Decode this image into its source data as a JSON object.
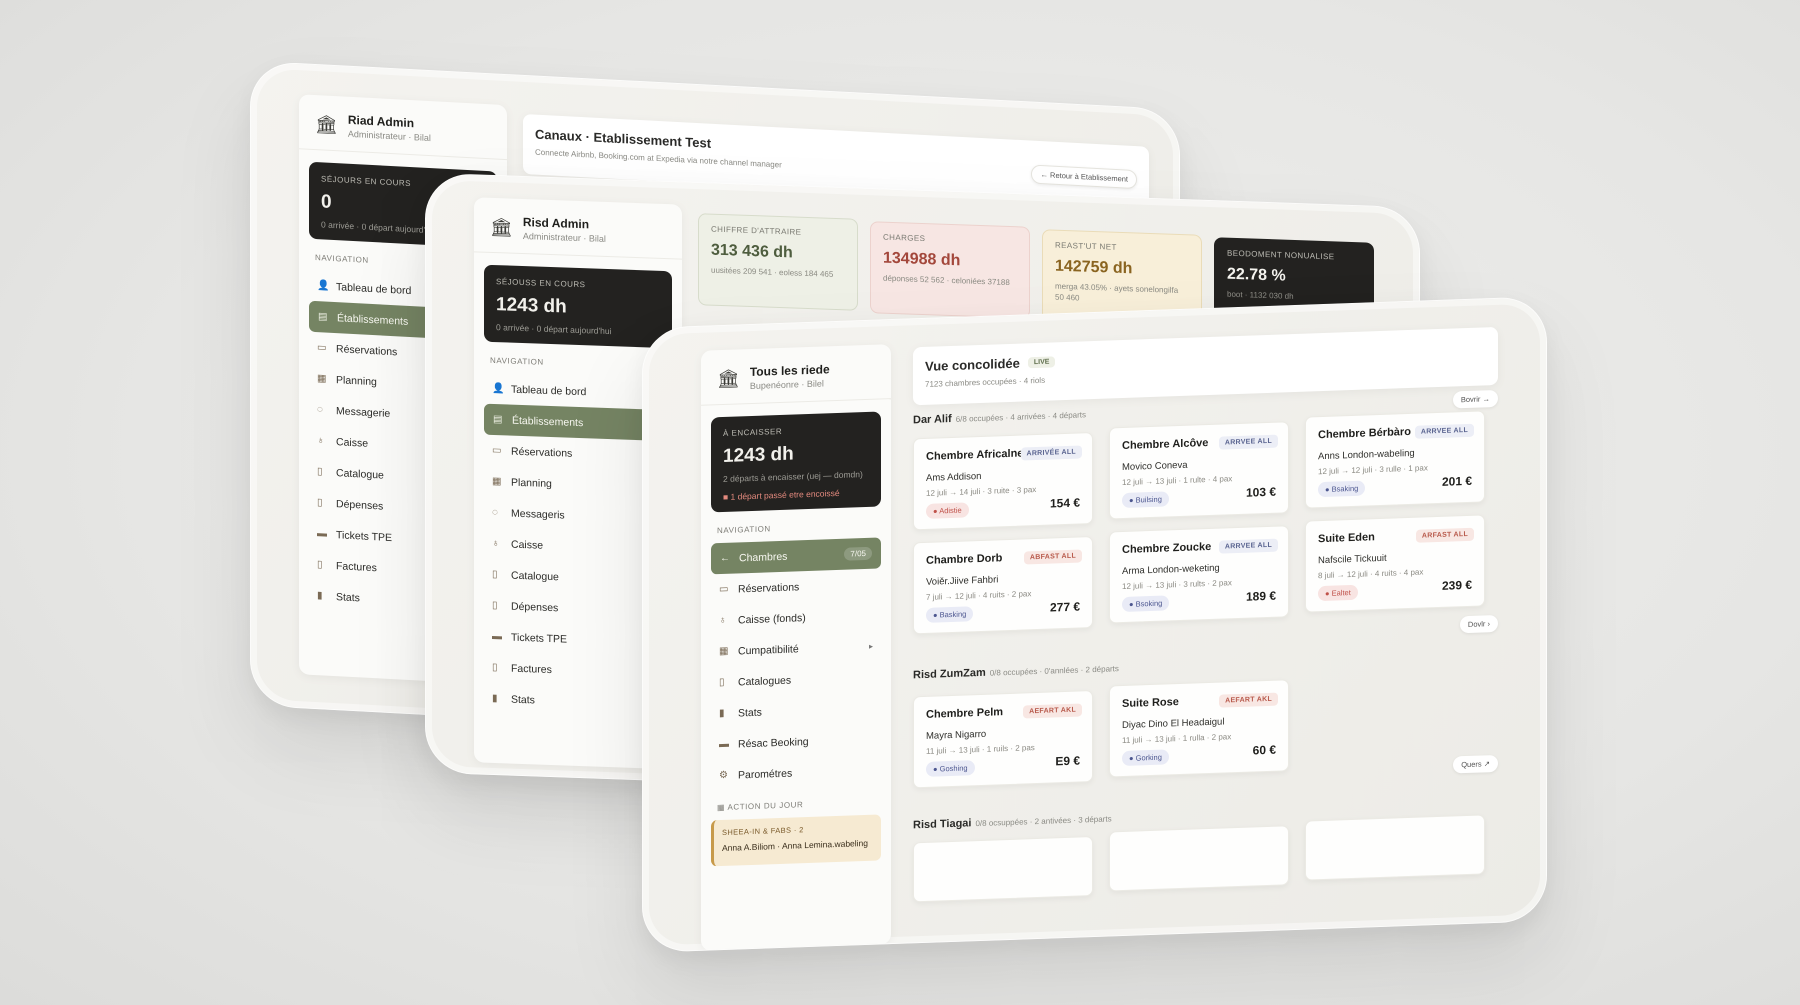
{
  "screen_back": {
    "brand": {
      "title": "Riad Admin",
      "subtitle": "Administrateur · Bilal"
    },
    "dark_card": {
      "label": "Séjours en cours",
      "value": "0",
      "sub": "0 arrivée · 0 départ aujourd'hui"
    },
    "nav_head": "Navigation",
    "nav": [
      {
        "icon": "person-icon",
        "glyph": "👤",
        "label": "Tableau de bord"
      },
      {
        "icon": "building-icon",
        "glyph": "▤",
        "label": "Établissements",
        "active": true
      },
      {
        "icon": "book-icon",
        "glyph": "▭",
        "label": "Réservations"
      },
      {
        "icon": "calendar-icon",
        "glyph": "▦",
        "label": "Planning"
      },
      {
        "icon": "chat-icon",
        "glyph": "◌",
        "label": "Messagerie"
      },
      {
        "icon": "moneybag-icon",
        "glyph": "♁",
        "label": "Caisse"
      },
      {
        "icon": "catalog-icon",
        "glyph": "▯",
        "label": "Catalogue"
      },
      {
        "icon": "document-icon",
        "glyph": "▯",
        "label": "Dépenses"
      },
      {
        "icon": "card-icon",
        "glyph": "▬",
        "label": "Tickets TPE"
      },
      {
        "icon": "invoice-icon",
        "glyph": "▯",
        "label": "Factures"
      },
      {
        "icon": "chart-icon",
        "glyph": "▮",
        "label": "Stats"
      }
    ],
    "header": {
      "title": "Canaux · Etablissement Test",
      "subtitle": "Connecte Airbnb, Booking.com at Expedia via notre channel manager",
      "back_button": "← Retour à Etablissement"
    }
  },
  "screen_mid": {
    "brand": {
      "title": "Risd Admin",
      "subtitle": "Administrateur · Bilal"
    },
    "dark_card": {
      "label": "Séjouss en cours",
      "value": "1243 dh",
      "sub": "0 arrivée · 0 départ aujourd'hui"
    },
    "nav_head": "Navigation",
    "nav": [
      {
        "icon": "person-icon",
        "glyph": "👤",
        "label": "Tableau de bord"
      },
      {
        "icon": "building-icon",
        "glyph": "▤",
        "label": "Établissements",
        "active": true
      },
      {
        "icon": "book-icon",
        "glyph": "▭",
        "label": "Réservations"
      },
      {
        "icon": "calendar-icon",
        "glyph": "▦",
        "label": "Planning"
      },
      {
        "icon": "chat-icon",
        "glyph": "◌",
        "label": "Messageris"
      },
      {
        "icon": "moneybag-icon",
        "glyph": "♁",
        "label": "Caisse"
      },
      {
        "icon": "catalog-icon",
        "glyph": "▯",
        "label": "Catalogue"
      },
      {
        "icon": "document-icon",
        "glyph": "▯",
        "label": "Dépenses"
      },
      {
        "icon": "card-icon",
        "glyph": "▬",
        "label": "Tickets TPE"
      },
      {
        "icon": "invoice-icon",
        "glyph": "▯",
        "label": "Factures"
      },
      {
        "icon": "chart-icon",
        "glyph": "▮",
        "label": "Stats"
      }
    ],
    "stats": [
      {
        "label": "Chiffre d'attraire",
        "value": "313 436 dh",
        "sub": "uusitées 209 541 · eoless 184 465",
        "bg": "#eef0e6",
        "border": "#d7dccb",
        "color": "#4e5d3e"
      },
      {
        "label": "Charges",
        "value": "134988 dh",
        "sub": "déponses 52 562 · celoniées 37188",
        "bg": "#f7e6e3",
        "border": "#ecd2cd",
        "color": "#a3473b"
      },
      {
        "label": "Reast'ut net",
        "value": "142759 dh",
        "sub": "merga 43.05% · ayets sonelongilfa 50 460",
        "bg": "#f8efd9",
        "border": "#eadcb8",
        "color": "#8a6420"
      },
      {
        "label": "Beodoment nonualise",
        "value": "22.78 %",
        "sub": "boot · 1132 030 dh",
        "bg": "#232220",
        "border": "#232220",
        "color": "#f4f3ee"
      }
    ]
  },
  "screen_front": {
    "brand": {
      "title": "Tous les riede",
      "subtitle": "Bupenéonre · Bilel"
    },
    "dark_card": {
      "label": "À encaisser",
      "value": "1243 dh",
      "sub": "2 départs à encaisser (uej — domdn)",
      "warn": "1 départ passé etre encoissé"
    },
    "nav_head": "Navigation",
    "nav": [
      {
        "icon": "arrow-left-icon",
        "glyph": "←",
        "label": "Chambres",
        "active": true,
        "badge": "7/05"
      },
      {
        "icon": "book-icon",
        "glyph": "▭",
        "label": "Réservations"
      },
      {
        "icon": "moneybag-icon",
        "glyph": "♁",
        "label": "Caisse (fonds)"
      },
      {
        "icon": "ledger-icon",
        "glyph": "▦",
        "label": "Cumpatibilité",
        "chevron": "▸"
      },
      {
        "icon": "catalog-icon",
        "glyph": "▯",
        "label": "Catalogues"
      },
      {
        "icon": "chart-icon",
        "glyph": "▮",
        "label": "Stats"
      },
      {
        "icon": "folder-icon",
        "glyph": "▬",
        "label": "Résac Beoking"
      },
      {
        "icon": "gear-icon",
        "glyph": "⚙",
        "label": "Parométres"
      }
    ],
    "action_head": "Action du jour",
    "action_card": {
      "label": "Sheea-in & fabs · 2",
      "text": "Anna A.Biliom · Anna Lemina.wabeling"
    },
    "header": {
      "title": "Vue concolidée",
      "live": "LIVE",
      "sub": "7123 chambres occupées · 4 riols"
    },
    "groups": [
      {
        "title": "Dar Alif",
        "sub": "6/8 occupées · 4 arrivées · 4 départs",
        "btn": "Bovrir →"
      },
      {
        "title": "Risd ZumZam",
        "sub": "0/8 occupées · 0'annlées · 2 départs",
        "btn": "Dovlr ›"
      },
      {
        "title": "Risd Tiagai",
        "sub": "0/8 ocsuppées · 2 antivées · 3 départs",
        "btn": "Quers ↗"
      }
    ],
    "rooms": [
      {
        "name": "Chembre Africalne",
        "guest": "Ams Addison",
        "dates": "12 juli → 14 juli · 3 ruite · 3 pax",
        "tag": "ARRIVÉE ALL",
        "tagType": "arr",
        "src": "● Adistie",
        "srcType": "ab",
        "price": "154 €"
      },
      {
        "name": "Chembre Alcôve",
        "guest": "Movico Coneva",
        "dates": "12 juli → 13 juli · 1 rulte · 4 pax",
        "tag": "ARRVEE ALL",
        "tagType": "arr",
        "src": "● Builsing",
        "srcType": "bk",
        "price": "103 €"
      },
      {
        "name": "Chembre Bérbàro",
        "guest": "Anns London-wabeling",
        "dates": "12 juli → 12 juli · 3 rulle · 1 pax",
        "tag": "ARRVEE ALL",
        "tagType": "arr",
        "src": "● Bsaking",
        "srcType": "bk",
        "price": "201 €"
      },
      {
        "name": "Chambre Dorb",
        "guest": "Voiěr.Jiive Fahbri",
        "dates": "7 juli → 12 juli · 4 ruits · 2 pax",
        "tag": "ABFAST ALL",
        "tagType": "dep",
        "src": "● Basking",
        "srcType": "bk",
        "price": "277 €"
      },
      {
        "name": "Chembre Zoucke",
        "guest": "Arma London-weketing",
        "dates": "12 juli → 13 juli · 3 rults · 2 pax",
        "tag": "ARRVEE ALL",
        "tagType": "arr",
        "src": "● Bsoking",
        "srcType": "bk",
        "price": "189 €"
      },
      {
        "name": "Suite Eden",
        "guest": "Nafscile Tickuuit",
        "dates": "8 juli → 12 juli · 4 ruits · 4 pax",
        "tag": "ARFAST ALL",
        "tagType": "dep",
        "src": "● Ealtet",
        "srcType": "ab",
        "price": "239 €"
      },
      {
        "name": "Chembre Pelm",
        "guest": "Mayra Nigarro",
        "dates": "11 juli → 13 juli · 1 ruils · 2 pas",
        "tag": "AEFART AKL",
        "tagType": "dep",
        "src": "● Goshing",
        "srcType": "bk",
        "price": "E9 €"
      },
      {
        "name": "Suite Rose",
        "guest": "Diyac Dino El Headaigul",
        "dates": "11 juli → 13 juli · 1 rulla · 2 pax",
        "tag": "AEFART AKL",
        "tagType": "dep",
        "src": "● Gorking",
        "srcType": "bk",
        "price": "60 €"
      }
    ]
  }
}
